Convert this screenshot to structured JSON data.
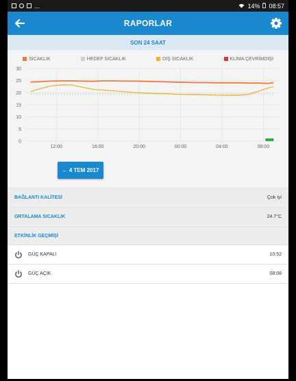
{
  "status_bar": {
    "battery": "14%",
    "time": "08:57",
    "dots": "..."
  },
  "app_bar": {
    "title": "RAPORLAR"
  },
  "period": {
    "label": "SON 24 SAAT"
  },
  "legend": [
    {
      "label": "SICAKLIK",
      "color": "#ec7b3b"
    },
    {
      "label": "HEDEF SICAKLIK",
      "color": "#cfcfcf"
    },
    {
      "label": "DIŞ SICAKLIK",
      "color": "#efb431"
    },
    {
      "label": "KLİMA ÇEVRİMDIŞI",
      "color": "#e33434"
    }
  ],
  "chart_data": {
    "type": "line",
    "title": "",
    "xlabel": "",
    "ylabel": "",
    "ylim": [
      0,
      30
    ],
    "yticks": [
      "30",
      "25",
      "20",
      "15",
      "10",
      "5",
      "0"
    ],
    "xticks": [
      "12:00",
      "16:00",
      "20:00",
      "00:00",
      "04:00",
      "08:00"
    ],
    "x_hours": [
      9.5,
      10.5,
      11.5,
      12.5,
      13.5,
      14.5,
      15.5,
      16.5,
      17.5,
      18.5,
      19.5,
      20.5,
      21.5,
      22.5,
      23.5,
      24.5,
      25.5,
      26.5,
      27.5,
      28.5,
      29.5,
      30.5,
      31.5,
      32.5,
      33
    ],
    "series": [
      {
        "name": "SICAKLIK",
        "color": "#ec7b3b",
        "values": [
          24.4,
          24.6,
          24.8,
          24.9,
          24.9,
          24.8,
          24.7,
          24.9,
          24.9,
          24.8,
          24.8,
          24.7,
          24.6,
          24.5,
          24.4,
          24.3,
          24.2,
          24.2,
          24.1,
          24.1,
          24.1,
          24.0,
          24.0,
          23.9,
          24.2
        ]
      },
      {
        "name": "HEDEF SICAKLIK",
        "color": "#cfcfcf",
        "values": [
          19.5,
          19.5,
          19.5,
          19.5,
          19.5,
          19.5,
          19.5,
          19.5,
          19.5,
          19.5,
          19.5,
          19.5,
          19.5,
          19.5,
          19.5,
          19.5,
          19.5,
          19.5,
          19.5,
          19.5,
          19.5,
          19.5,
          19.5,
          19.5,
          19.5
        ]
      },
      {
        "name": "DIŞ SICAKLIK",
        "color": "#efb431",
        "values": [
          20.5,
          21.8,
          22.8,
          23.3,
          23.2,
          22.3,
          21.4,
          21.1,
          20.8,
          20.4,
          20.1,
          19.9,
          19.7,
          19.6,
          19.4,
          19.3,
          19.2,
          19.1,
          19.0,
          18.9,
          18.9,
          19.3,
          20.6,
          22.0,
          22.5
        ]
      }
    ]
  },
  "date_button": {
    "label": "← 4 TEM 2017"
  },
  "connection": {
    "label": "BAĞLANTI KALİTESİ",
    "value": "Çok iyi"
  },
  "average": {
    "label": "ORTALAMA SICAKLIK",
    "value": "24.7°C"
  },
  "history": {
    "label": "ETKİNLİK GEÇMİŞİ"
  },
  "events": [
    {
      "label": "GÜÇ KAPALI",
      "time": "10:52",
      "icon": "power-icon"
    },
    {
      "label": "GÜÇ AÇIK",
      "time": "08:08",
      "icon": "power-icon"
    }
  ]
}
